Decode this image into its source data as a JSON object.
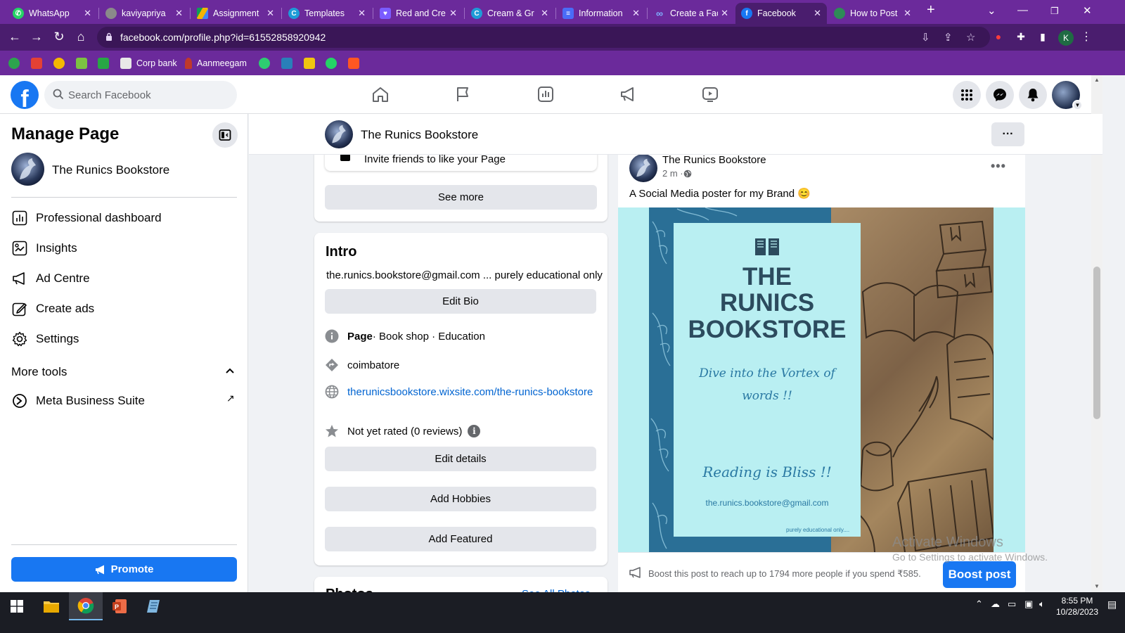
{
  "browser": {
    "tabs": [
      {
        "title": "WhatsApp",
        "icon": "whatsapp-icon",
        "color": "#25d366"
      },
      {
        "title": "kaviyapriya",
        "icon": "globe-icon",
        "color": "#8a8a8a"
      },
      {
        "title": "Assignment",
        "icon": "drive-icon",
        "color": "#f4b400"
      },
      {
        "title": "Templates",
        "icon": "canva-icon",
        "color": "#1e9bd7"
      },
      {
        "title": "Red and Cre",
        "icon": "heart-icon",
        "color": "#7a5cff"
      },
      {
        "title": "Cream & Gr",
        "icon": "canva-icon",
        "color": "#1e9bd7"
      },
      {
        "title": "Information",
        "icon": "doc-icon",
        "color": "#4a6cf7"
      },
      {
        "title": "Create a Fac",
        "icon": "meta-icon",
        "color": "#0a66ff"
      },
      {
        "title": "Facebook",
        "icon": "facebook-icon",
        "color": "#1877f2",
        "active": true
      },
      {
        "title": "How to Post",
        "icon": "globe-icon",
        "color": "#2e8b57"
      }
    ],
    "url": "facebook.com/profile.php?id=61552858920942",
    "profile_initial": "K",
    "bookmarks": [
      {
        "label": "",
        "color": "#2da44e"
      },
      {
        "label": "",
        "color": "#e44134"
      },
      {
        "label": "",
        "color": "#f5b800"
      },
      {
        "label": "",
        "color": "#7cc242"
      },
      {
        "label": "",
        "color": "#28a745"
      },
      {
        "label": "Corp bank",
        "color": "#e8e8e8"
      },
      {
        "label": "Aanmeegam",
        "color": "#c0392b"
      },
      {
        "label": "",
        "color": "#2ecc71"
      },
      {
        "label": "",
        "color": "#2980b9"
      },
      {
        "label": "",
        "color": "#f1c40f"
      },
      {
        "label": "",
        "color": "#25d366"
      },
      {
        "label": "",
        "color": "#ff5722"
      }
    ]
  },
  "facebook": {
    "search_placeholder": "Search Facebook",
    "logo_letter": "f",
    "nav_icons": [
      "home-icon",
      "flag-icon",
      "dashboard-icon",
      "megaphone-icon",
      "video-icon"
    ],
    "accent": "#1877f2"
  },
  "sidebar": {
    "title": "Manage Page",
    "page_name": "The Runics Bookstore",
    "items": [
      {
        "label": "Professional dashboard",
        "icon": "dashboard-icon"
      },
      {
        "label": "Insights",
        "icon": "insights-icon"
      },
      {
        "label": "Ad Centre",
        "icon": "megaphone-icon"
      },
      {
        "label": "Create ads",
        "icon": "pencil-icon"
      },
      {
        "label": "Settings",
        "icon": "gear-icon"
      }
    ],
    "more_tools": "More tools",
    "meta_business": "Meta Business Suite",
    "promote": "Promote"
  },
  "page_header": {
    "name": "The Runics Bookstore",
    "more": "···"
  },
  "left_column": {
    "invite_text": "Invite friends to like your Page",
    "see_more": "See more",
    "intro": {
      "title": "Intro",
      "bio": "the.runics.bookstore@gmail.com ... purely educational only",
      "edit_bio": "Edit Bio",
      "page_label": "Page",
      "categories": " · Book shop · Education",
      "location": "coimbatore",
      "website": "therunicsbookstore.wixsite.com/the-runics-bookstore",
      "rating": "Not yet rated (0 reviews)",
      "edit_details": "Edit details",
      "add_hobbies": "Add Hobbies",
      "add_featured": "Add Featured"
    },
    "photos_title": "Photos",
    "see_all_photos": "See All Photos"
  },
  "post": {
    "author": "The Runics Bookstore",
    "time": "2 m · ",
    "text": "A Social Media poster for my Brand 😊",
    "poster": {
      "title_lines": [
        "THE",
        "RUNICS",
        "BOOKSTORE"
      ],
      "tagline_1": "Dive into the Vortex of",
      "tagline_2": "words !!",
      "tagline_3": "Reading is Bliss !!",
      "email": "the.runics.bookstore@gmail.com",
      "note": "purely educational only...."
    },
    "boost_text": "Boost this post to reach up to 1794 more people if you spend ₹585.",
    "boost_button": "Boost post"
  },
  "watermark": {
    "line1": "Activate Windows",
    "line2": "Go to Settings to activate Windows."
  },
  "taskbar": {
    "time": "8:55 PM",
    "date": "10/28/2023"
  }
}
